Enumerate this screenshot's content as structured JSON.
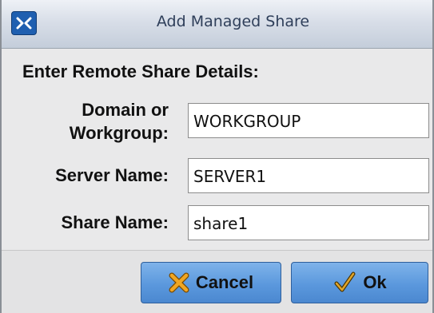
{
  "dialog": {
    "title": "Add Managed Share",
    "app_icon": "app-logo-icon"
  },
  "form": {
    "heading": "Enter Remote Share Details:",
    "domain_label_line1": "Domain or",
    "domain_label_line2": "Workgroup:",
    "domain_value": "WORKGROUP",
    "server_label": "Server Name:",
    "server_value": "SERVER1",
    "share_label": "Share Name:",
    "share_value": "share1"
  },
  "buttons": {
    "cancel_label": "Cancel",
    "cancel_icon": "x-icon",
    "ok_label": "Ok",
    "ok_icon": "checkmark-icon"
  }
}
